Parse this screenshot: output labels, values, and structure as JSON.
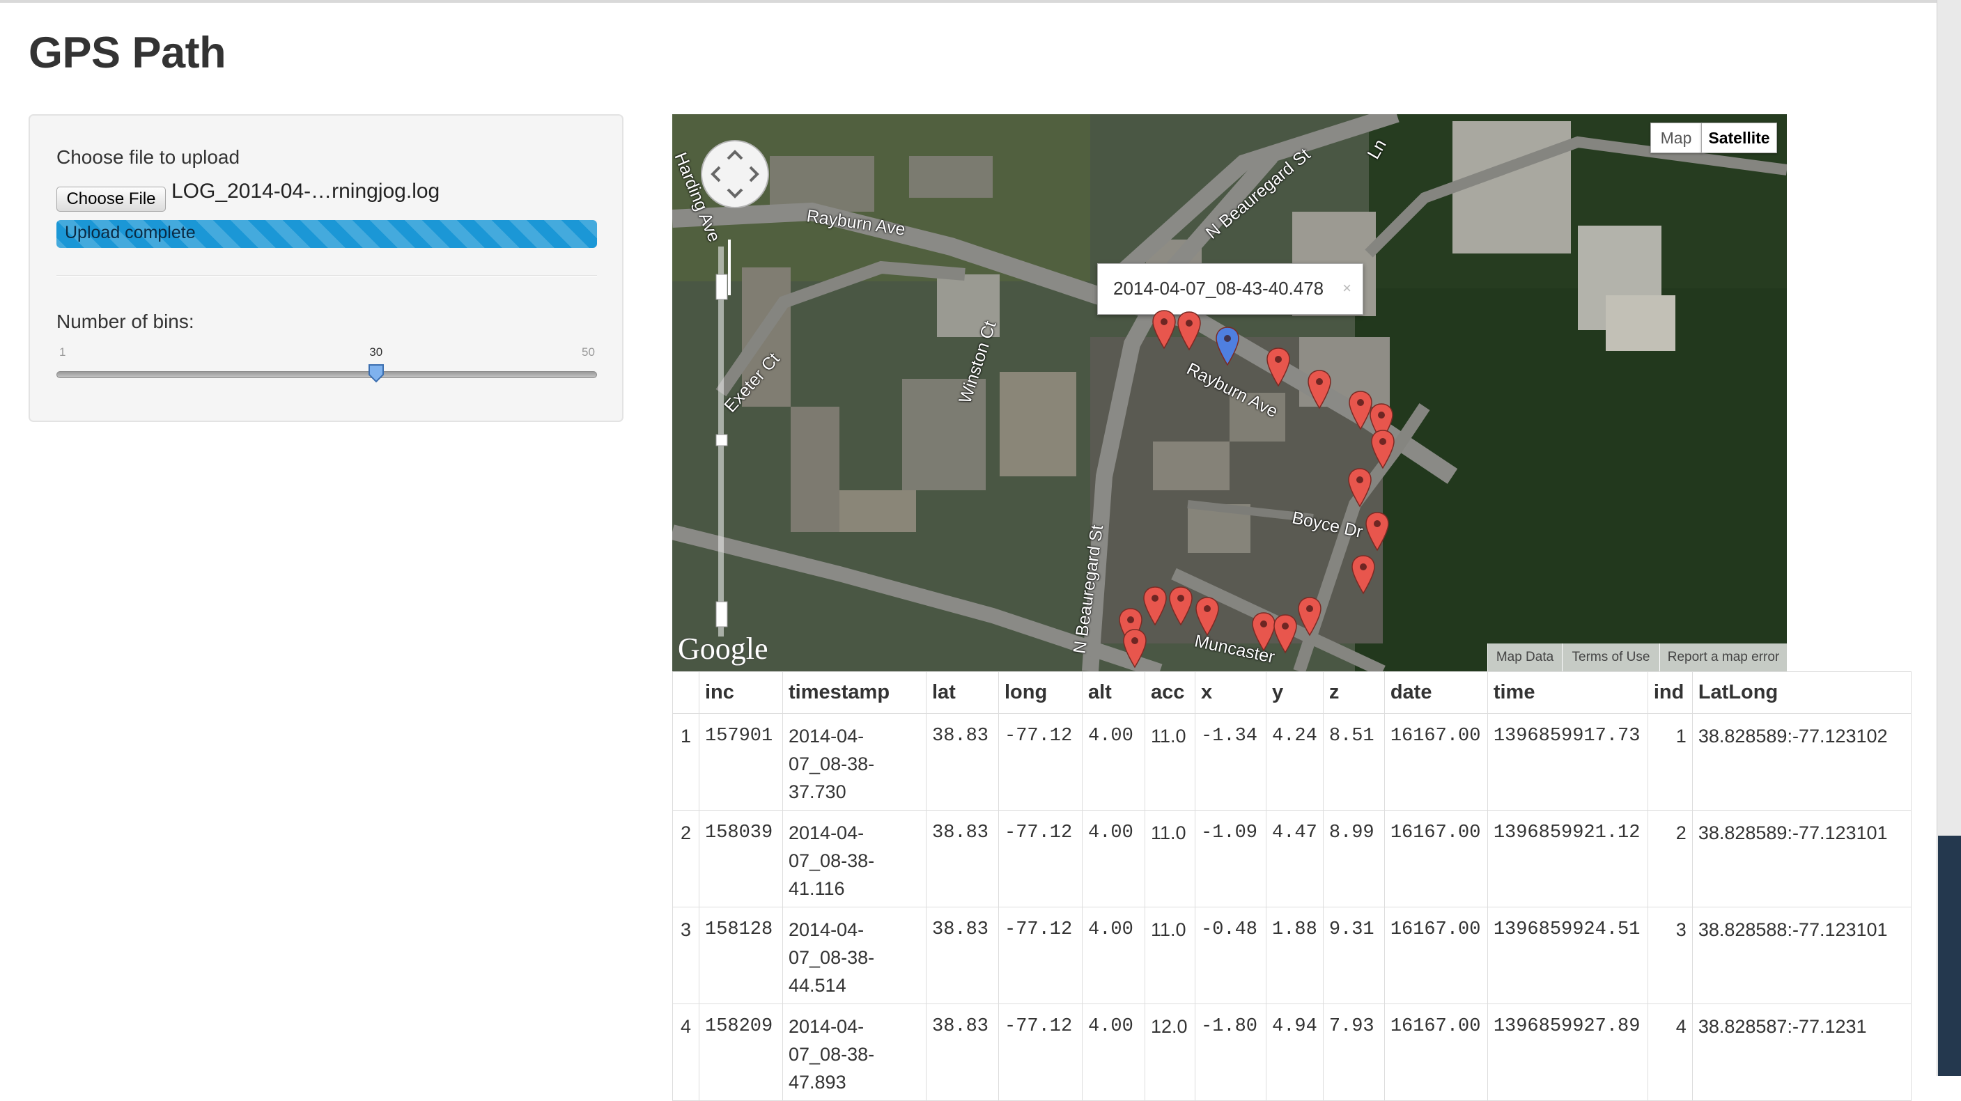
{
  "page": {
    "title": "GPS Path"
  },
  "sidebar": {
    "file_label": "Choose file to upload",
    "choose_file_label": "Choose File",
    "file_name": "LOG_2014-04-…rningjog.log",
    "progress_text": "Upload complete",
    "progress_fraction": 1.0,
    "bins_label": "Number of bins:",
    "slider": {
      "min": "1",
      "max": "50",
      "value": "30"
    }
  },
  "map": {
    "type_buttons": {
      "map": "Map",
      "satellite": "Satellite",
      "selected": "Satellite"
    },
    "infowindow_text": "2014-04-07_08-43-40.478",
    "streets": {
      "rayburn_1": "Rayburn Ave",
      "rayburn_2": "Rayburn Ave",
      "harding": "Harding Ave",
      "exeter": "Exeter Ct",
      "winston": "Winston Ct",
      "beauregard_1": "N Beauregard St",
      "beauregard_2": "N Beauregard St",
      "boyce": "Boyce Dr",
      "muncaster": "Muncaster",
      "ln": "Ln"
    },
    "logo": "Google",
    "footer": {
      "map_data": "Map Data",
      "terms": "Terms of Use",
      "report": "Report a map error"
    },
    "colors": {
      "marker_red": "#e8564d",
      "marker_blue": "#4f7fe0"
    }
  },
  "table": {
    "columns": [
      "",
      "inc",
      "timestamp",
      "lat",
      "long",
      "alt",
      "acc",
      "x",
      "y",
      "z",
      "date",
      "time",
      "ind",
      "LatLong"
    ],
    "rows": [
      [
        "1",
        "157901",
        "2014-04-07_08-38-37.730",
        "38.83",
        "-77.12",
        "4.00",
        "11.0",
        "-1.34",
        "4.24",
        "8.51",
        "16167.00",
        "1396859917.73",
        "1",
        "38.828589:-77.123102"
      ],
      [
        "2",
        "158039",
        "2014-04-07_08-38-41.116",
        "38.83",
        "-77.12",
        "4.00",
        "11.0",
        "-1.09",
        "4.47",
        "8.99",
        "16167.00",
        "1396859921.12",
        "2",
        "38.828589:-77.123101"
      ],
      [
        "3",
        "158128",
        "2014-04-07_08-38-44.514",
        "38.83",
        "-77.12",
        "4.00",
        "11.0",
        "-0.48",
        "1.88",
        "9.31",
        "16167.00",
        "1396859924.51",
        "3",
        "38.828588:-77.123101"
      ],
      [
        "4",
        "158209",
        "2014-04-07_08-38-47.893",
        "38.83",
        "-77.12",
        "4.00",
        "12.0",
        "-1.80",
        "4.94",
        "7.93",
        "16167.00",
        "1396859927.89",
        "4",
        "38.828587:-77.1231"
      ]
    ]
  }
}
